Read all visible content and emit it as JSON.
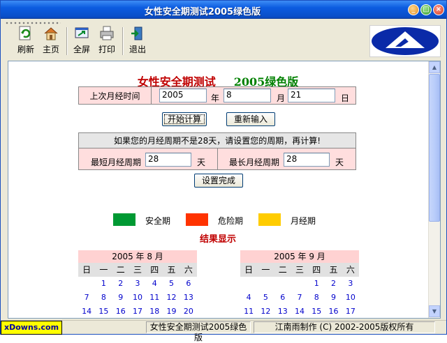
{
  "window": {
    "title": "女性安全期测试2005绿色版"
  },
  "toolbar": {
    "items": [
      {
        "label": "刷新",
        "icon": "refresh-icon"
      },
      {
        "label": "主页",
        "icon": "home-icon"
      },
      {
        "label": "全屏",
        "icon": "fullscreen-icon"
      },
      {
        "label": "打印",
        "icon": "printer-icon"
      },
      {
        "label": "退出",
        "icon": "exit-icon"
      }
    ]
  },
  "heading": {
    "main": "女性安全期测试",
    "edition": "2005绿色版"
  },
  "last_period": {
    "label": "上次月经时间",
    "year": "2005",
    "year_unit": "年",
    "month": "8",
    "month_unit": "月",
    "day": "21",
    "day_unit": "日"
  },
  "buttons": {
    "calculate": "开始计算",
    "reset": "重新输入",
    "settings_done": "设置完成"
  },
  "cycle": {
    "notice": "如果您的月经周期不是28天，请设置您的周期，再计算!",
    "min_label": "最短月经周期",
    "min_value": "28",
    "min_unit": "天",
    "max_label": "最长月经周期",
    "max_value": "28",
    "max_unit": "天"
  },
  "legend": {
    "safe": "安全期",
    "danger": "危险期",
    "period": "月经期",
    "colors": {
      "safe": "#009933",
      "danger": "#ff3300",
      "period": "#ffcc00"
    }
  },
  "result_title": "结果显示",
  "calendars": [
    {
      "title": "2005 年 8 月",
      "weekdays": [
        "日",
        "一",
        "二",
        "三",
        "四",
        "五",
        "六"
      ],
      "rows": [
        [
          "",
          "1",
          "2",
          "3",
          "4",
          "5",
          "6"
        ],
        [
          "7",
          "8",
          "9",
          "10",
          "11",
          "12",
          "13"
        ],
        [
          "14",
          "15",
          "16",
          "17",
          "18",
          "19",
          "20"
        ]
      ]
    },
    {
      "title": "2005 年 9 月",
      "weekdays": [
        "日",
        "一",
        "二",
        "三",
        "四",
        "五",
        "六"
      ],
      "rows": [
        [
          "",
          "",
          "",
          "",
          "1",
          "2",
          "3"
        ],
        [
          "4",
          "5",
          "6",
          "7",
          "8",
          "9",
          "10"
        ],
        [
          "11",
          "12",
          "13",
          "14",
          "15",
          "16",
          "17"
        ]
      ]
    }
  ],
  "statusbar": {
    "badge": "xDowns.com",
    "app": "女性安全期测试2005绿色版",
    "copyright": "江南雨制作 (C) 2002-2005版权所有"
  }
}
